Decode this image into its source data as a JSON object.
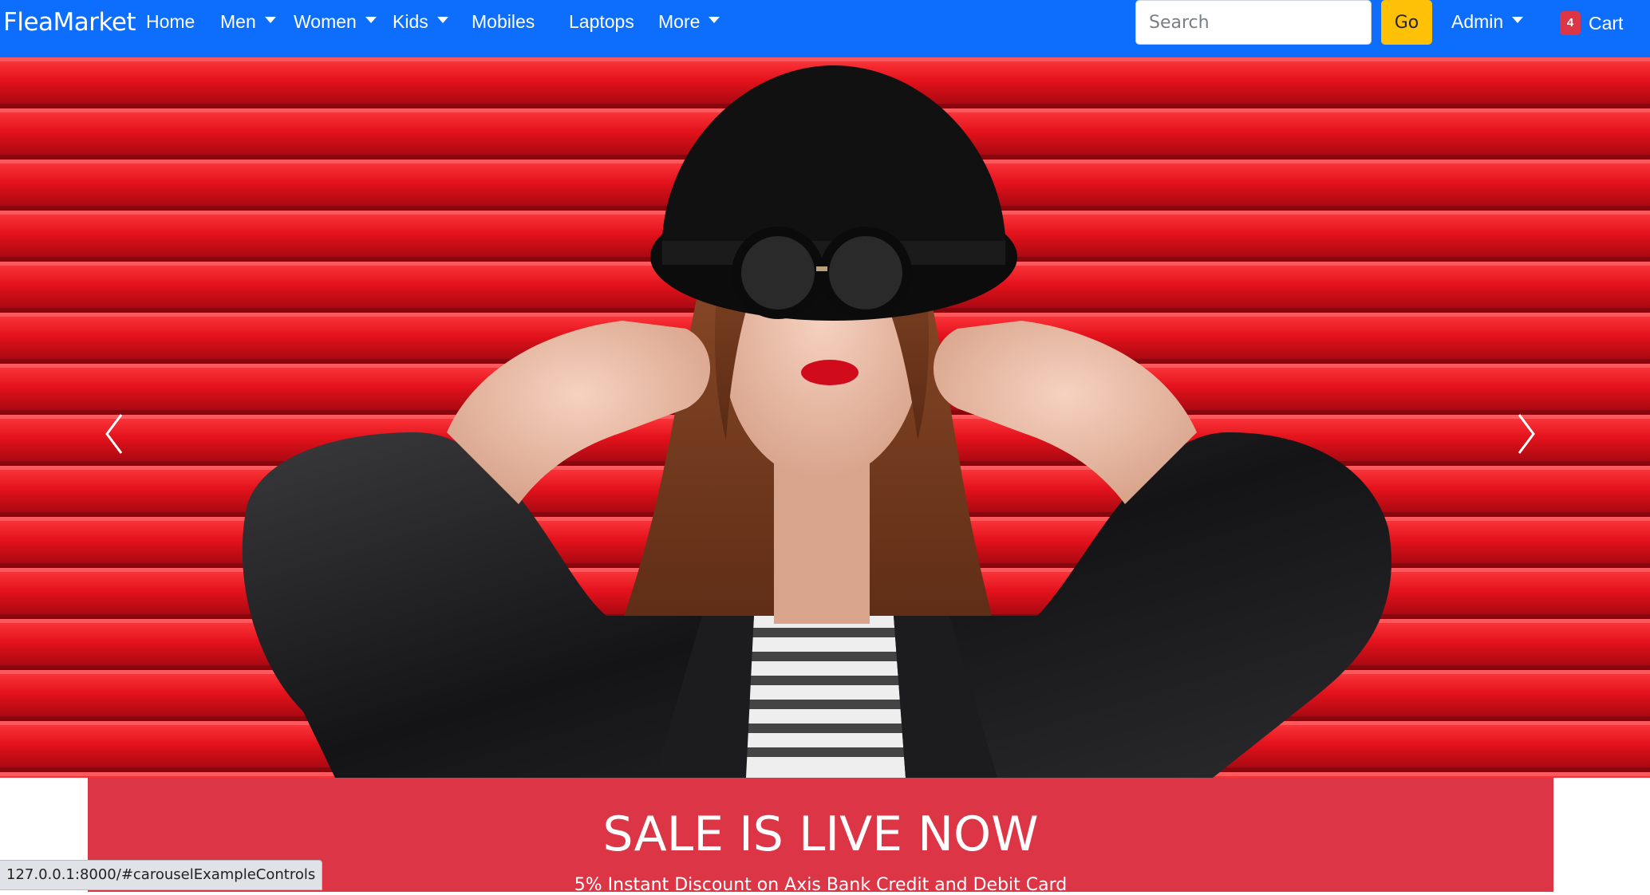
{
  "navbar": {
    "brand": "FleaMarket",
    "items": [
      {
        "label": "Home",
        "dropdown": false
      },
      {
        "label": "Men",
        "dropdown": true
      },
      {
        "label": "Women",
        "dropdown": true
      },
      {
        "label": "Kids",
        "dropdown": true
      },
      {
        "label": "Mobiles",
        "dropdown": false
      },
      {
        "label": "Laptops",
        "dropdown": false
      },
      {
        "label": "More",
        "dropdown": true
      }
    ],
    "search_placeholder": "Search",
    "go_label": "Go",
    "admin_label": "Admin",
    "cart_count": "4",
    "cart_label": "Cart",
    "color": "#0d6efd"
  },
  "carousel": {
    "prev_icon": "chevron-left-icon",
    "next_icon": "chevron-right-icon"
  },
  "sale": {
    "title": "SALE IS LIVE NOW",
    "subtitle": "5% Instant Discount on Axis Bank Credit and Debit Card",
    "color": "#dc3545"
  },
  "status_bar": {
    "url": "127.0.0.1:8000/#carouselExampleControls"
  }
}
